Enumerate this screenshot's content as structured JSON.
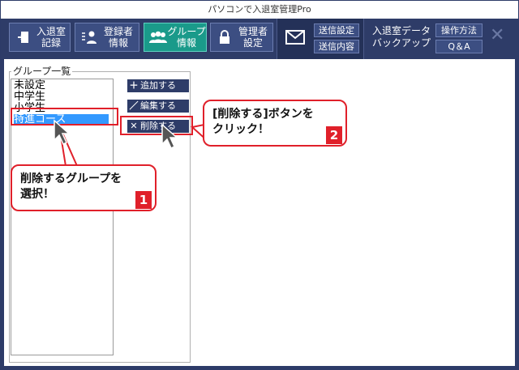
{
  "window": {
    "title": "パソコンで入退室管理Pro"
  },
  "toolbar": {
    "entry_exit": "入退室\n記録",
    "registrant": "登録者\n情報",
    "group": "グループ\n情報",
    "admin": "管理者\n設定",
    "send_settings": "送信設定",
    "send_content": "送信内容",
    "backup": "入退室データ\nバックアップ",
    "howto": "操作方法",
    "qa": "Q＆A"
  },
  "group_panel": {
    "title": "グループ一覧",
    "items": [
      "未設定",
      "中学生",
      "小学生",
      "特進コース"
    ],
    "selected_index": 3
  },
  "actions": {
    "add": "追加する",
    "edit": "編集する",
    "delete": "削除する"
  },
  "callouts": {
    "select_line1": "削除するグループを",
    "select_line2": "選択！",
    "select_step": "1",
    "click_line1": "[削除する]ボタンを",
    "click_line2": "クリック！",
    "click_step": "2"
  },
  "colors": {
    "accent": "#e0202a",
    "toolbar_bg": "#2e3c68",
    "active_tab": "#1a9a8a",
    "selection": "#3399ff"
  }
}
